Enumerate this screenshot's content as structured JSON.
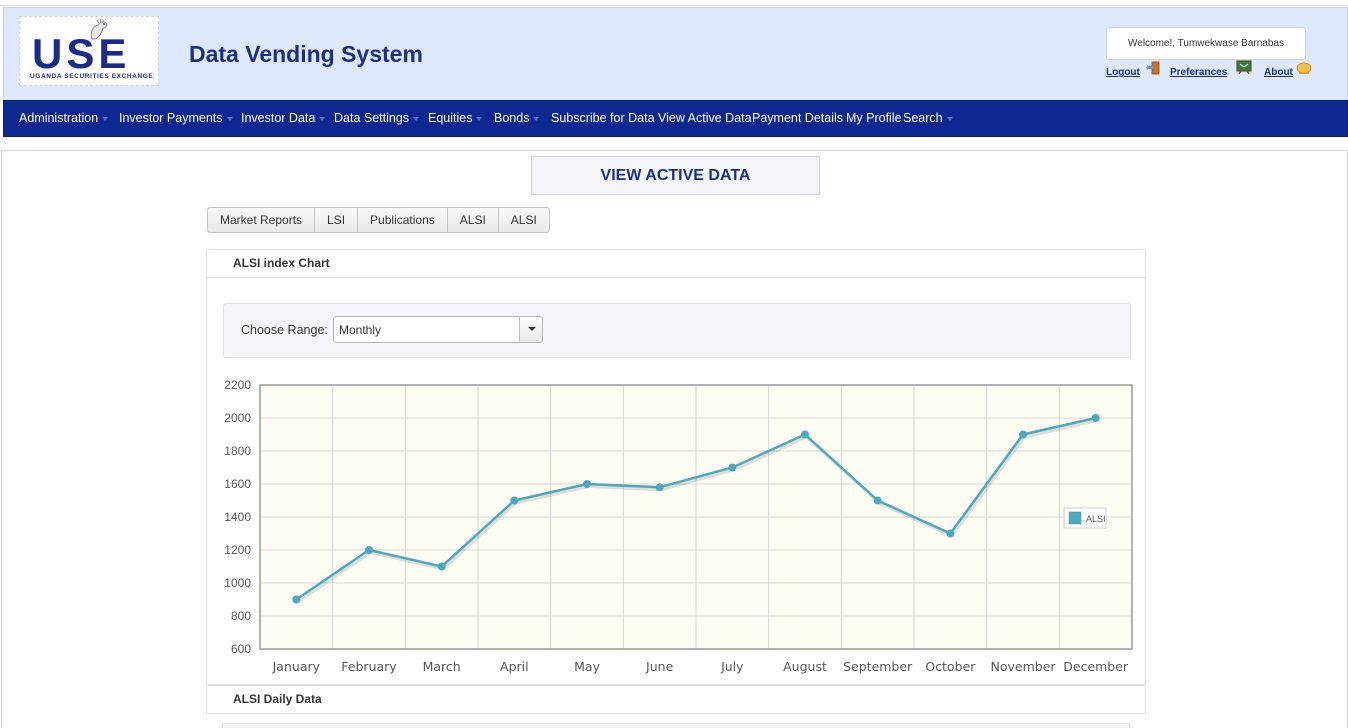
{
  "header": {
    "logo_letters": "USE",
    "logo_subtitle": "UGANDA SECURITIES EXCHANGE",
    "app_title": "Data Vending System",
    "welcome_text": "Welcome!, Tumwekwase Barnabas",
    "links": [
      {
        "label": "Logout",
        "icon": "logout-door-icon"
      },
      {
        "label": "Preferances",
        "icon": "preferences-board-icon"
      },
      {
        "label": "About",
        "icon": "about-info-icon"
      }
    ]
  },
  "nav": {
    "items": [
      {
        "label": "Administration",
        "has_menu": true
      },
      {
        "label": "Investor Payments",
        "has_menu": true
      },
      {
        "label": "Investor Data",
        "has_menu": true
      },
      {
        "label": "Data Settings",
        "has_menu": true
      },
      {
        "label": "Equities",
        "has_menu": true
      },
      {
        "label": "Bonds",
        "has_menu": true
      },
      {
        "label": "Subscribe for Data",
        "has_menu": false
      },
      {
        "label": "View Active Data",
        "has_menu": false
      },
      {
        "label": "Payment Details",
        "has_menu": false
      },
      {
        "label": "My Profile",
        "has_menu": false
      },
      {
        "label": "Search",
        "has_menu": true
      }
    ]
  },
  "main": {
    "page_title": "VIEW ACTIVE DATA",
    "tabs": [
      "Market Reports",
      "LSI",
      "Publications",
      "ALSI",
      "ALSI"
    ],
    "chart_panel_title": "ALSI index Chart",
    "range_label": "Choose Range:",
    "range_value": "Monthly",
    "daily_panel_title": "ALSI Daily Data"
  },
  "colors": {
    "header_bg": "#dde9fa",
    "nav_bg": "#0d2891",
    "brand_blue": "#1b2f8a",
    "series_line": "#4aa8bf",
    "plot_bg": "#fefcf3"
  },
  "chart_data": {
    "type": "line",
    "categories": [
      "January",
      "February",
      "March",
      "April",
      "May",
      "June",
      "July",
      "August",
      "September",
      "October",
      "November",
      "December"
    ],
    "series": [
      {
        "name": "ALSI",
        "values": [
          900,
          1200,
          1100,
          1500,
          1600,
          1580,
          1700,
          1900,
          1500,
          1300,
          1900,
          2000
        ]
      }
    ],
    "ylim": [
      600,
      2200
    ],
    "yticks": [
      600,
      800,
      1000,
      1200,
      1400,
      1600,
      1800,
      2000,
      2200
    ],
    "grid": true,
    "legend_position": "right"
  }
}
